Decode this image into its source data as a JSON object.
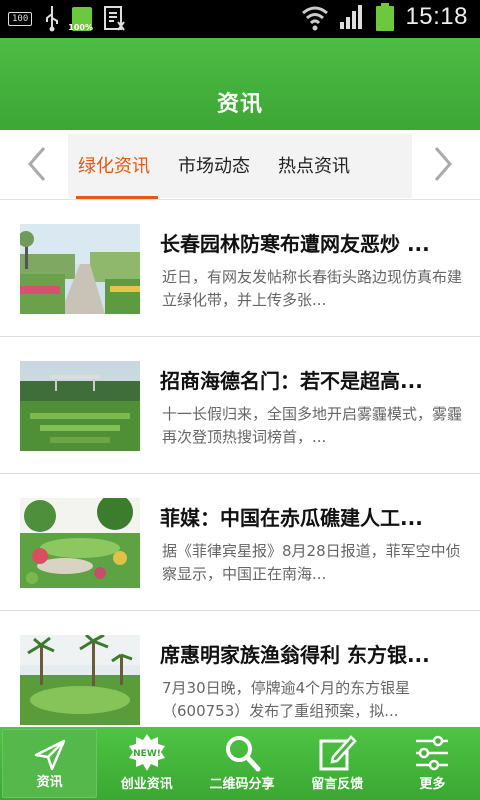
{
  "status_bar": {
    "left_box_text": "100",
    "battery_small_label": "100%",
    "time": "15:18"
  },
  "header": {
    "title": "资讯"
  },
  "tabs": [
    {
      "label": "绿化资讯",
      "active": true
    },
    {
      "label": "市场动态",
      "active": false
    },
    {
      "label": "热点资讯",
      "active": false
    }
  ],
  "news": [
    {
      "title": "长春园林防寒布遭网友恶炒 ...",
      "summary": "近日，有网友发帖称长春街头路边现仿真布建立绿化带，并上传多张..."
    },
    {
      "title": "招商海德名门：若不是超高...",
      "summary": "十一长假归来，全国多地开启雾霾模式，雾霾再次登顶热搜词榜首，..."
    },
    {
      "title": "菲媒：中国在赤瓜礁建人工...",
      "summary": "据《菲律宾星报》8月28日报道，菲军空中侦察显示，中国正在南海..."
    },
    {
      "title": "席惠明家族渔翁得利 东方银...",
      "summary": "7月30日晚，停牌逾4个月的东方银星（600753）发布了重组预案，拟..."
    }
  ],
  "bottom_nav": [
    {
      "label": "资讯",
      "icon": "send-icon",
      "active": true
    },
    {
      "label": "创业资讯",
      "icon": "new-badge-icon",
      "badge_text": "NEW!",
      "active": false
    },
    {
      "label": "二维码分享",
      "icon": "search-icon",
      "active": false
    },
    {
      "label": "留言反馈",
      "icon": "edit-icon",
      "active": false
    },
    {
      "label": "更多",
      "icon": "sliders-icon",
      "active": false
    }
  ],
  "colors": {
    "brand_green": "#3da636",
    "active_tab": "#e05a12"
  }
}
